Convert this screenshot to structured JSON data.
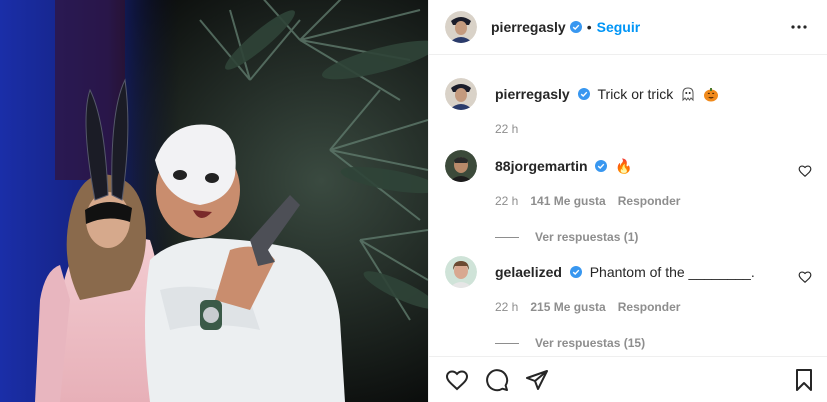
{
  "header": {
    "username": "pierregasly",
    "separator": "•",
    "follow_label": "Seguir",
    "more_icon": "more-horizontal-icon"
  },
  "caption": {
    "username": "pierregasly",
    "text": "Trick or trick",
    "emojis": [
      "ghost",
      "jack-o-lantern"
    ],
    "time": "22 h"
  },
  "comments": [
    {
      "username": "88jorgemartin",
      "text": "🔥",
      "time": "22 h",
      "likes": "141 Me gusta",
      "reply_label": "Responder",
      "view_replies": "Ver respuestas (1)"
    },
    {
      "username": "gelaelized",
      "text": "Phantom of the ________.",
      "time": "22 h",
      "likes": "215 Me gusta",
      "reply_label": "Responder",
      "view_replies": "Ver respuestas (15)"
    }
  ],
  "colors": {
    "accent": "#0095f6",
    "muted": "#8e8e8e",
    "text": "#262626",
    "border": "#efefef"
  }
}
